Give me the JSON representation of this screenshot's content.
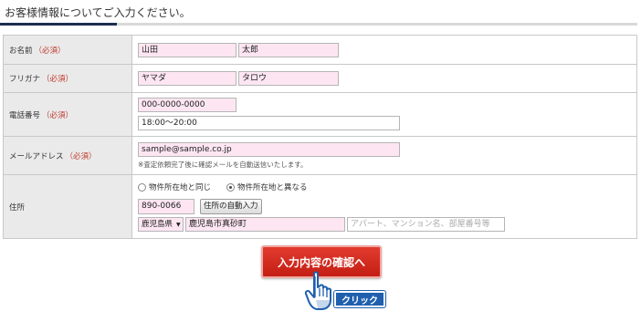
{
  "heading": "お客様情報についてご入力ください。",
  "form": {
    "required_mark": "（必須）",
    "name": {
      "label": "お名前",
      "last_value": "山田",
      "first_value": "太郎"
    },
    "furigana": {
      "label": "フリガナ",
      "last_value": "ヤマダ",
      "first_value": "タロウ"
    },
    "phone": {
      "label": "電話番号",
      "number_value": "000-0000-0000",
      "time_value": "18:00～20:00"
    },
    "email": {
      "label": "メールアドレス",
      "value": "sample@sample.co.jp",
      "note": "※査定依頼完了後に確認メールを自動送信いたします。"
    },
    "address": {
      "label": "住所",
      "radio_same": "物件所在地と同じ",
      "radio_different": "物件所在地と異なる",
      "postal_value": "890-0066",
      "auto_fill_button": "住所の自動入力",
      "prefecture_value": "鹿児島県",
      "city_value": "鹿児島市真砂町",
      "building_placeholder": "アパート、マンション名、部屋番号等"
    }
  },
  "submit_button": "入力内容の確認へ",
  "click_badge": "クリック",
  "colors": {
    "accent_navy": "#1c2e50",
    "required_red": "#c0392b",
    "input_pink": "#fde6f1",
    "button_red": "#c41e14",
    "badge_blue": "#1f5fae"
  }
}
